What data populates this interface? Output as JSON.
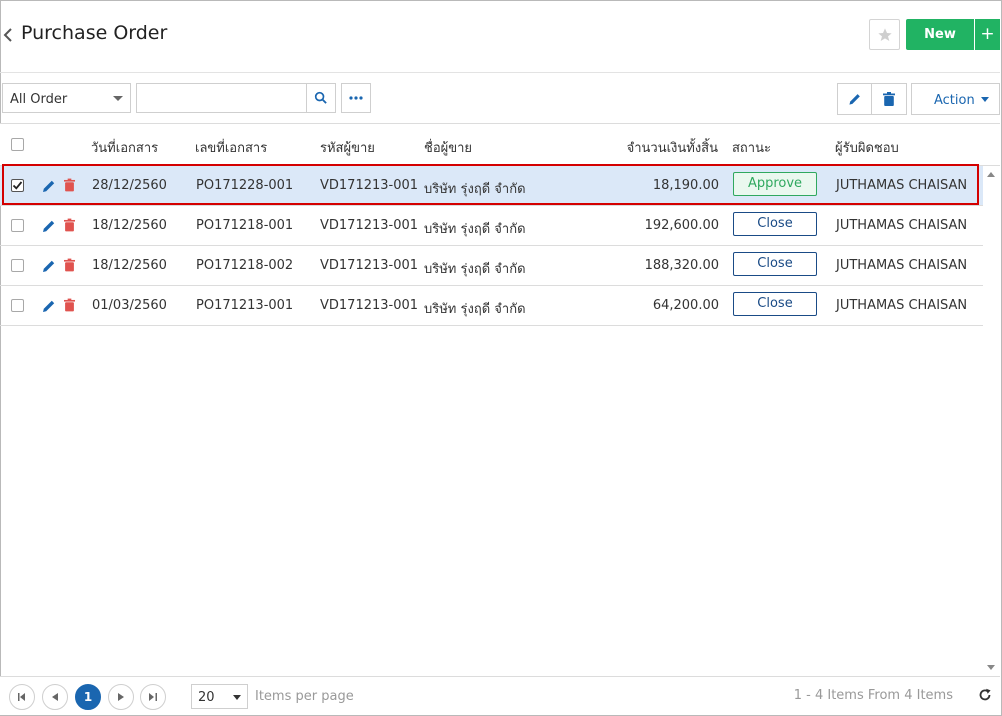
{
  "header": {
    "title": "Purchase Order",
    "new_label": "New",
    "new_plus": "+"
  },
  "toolbar": {
    "filter_value": "All Order",
    "search_value": "",
    "action_label": "Action"
  },
  "grid": {
    "columns": [
      "วันที่เอกสาร",
      "เลขที่เอกสาร",
      "รหัสผู้ขาย",
      "ชื่อผู้ขาย",
      "จำนวนเงินทั้งสิ้น",
      "สถานะ",
      "ผู้รับผิดชอบ"
    ],
    "rows": [
      {
        "date": "28/12/2560",
        "doc_no": "PO171228-001",
        "vendor_code": "VD171213-001",
        "vendor_name": "บริษัท รุ่งฤดี จำกัด",
        "amount": "18,190.00",
        "status": "Approve",
        "owner": "JUTHAMAS CHAISAN",
        "checked": true
      },
      {
        "date": "18/12/2560",
        "doc_no": "PO171218-001",
        "vendor_code": "VD171213-001",
        "vendor_name": "บริษัท รุ่งฤดี จำกัด",
        "amount": "192,600.00",
        "status": "Close",
        "owner": "JUTHAMAS CHAISAN",
        "checked": false
      },
      {
        "date": "18/12/2560",
        "doc_no": "PO171218-002",
        "vendor_code": "VD171213-001",
        "vendor_name": "บริษัท รุ่งฤดี จำกัด",
        "amount": "188,320.00",
        "status": "Close",
        "owner": "JUTHAMAS CHAISAN",
        "checked": false
      },
      {
        "date": "01/03/2560",
        "doc_no": "PO171213-001",
        "vendor_code": "VD171213-001",
        "vendor_name": "บริษัท รุ่งฤดี จำกัด",
        "amount": "64,200.00",
        "status": "Close",
        "owner": "JUTHAMAS CHAISAN",
        "checked": false
      }
    ]
  },
  "pager": {
    "current_page": "1",
    "page_size": "20",
    "items_per_page_label": "Items per page",
    "info": "1 - 4 Items From 4 Items"
  },
  "colors": {
    "accent": "#1a66b0",
    "new_button": "#21b363",
    "delete_icon": "#e0534f",
    "approve": "#2fa85f",
    "selected_row": "#dbe8f8",
    "highlight_border": "#d40000"
  }
}
